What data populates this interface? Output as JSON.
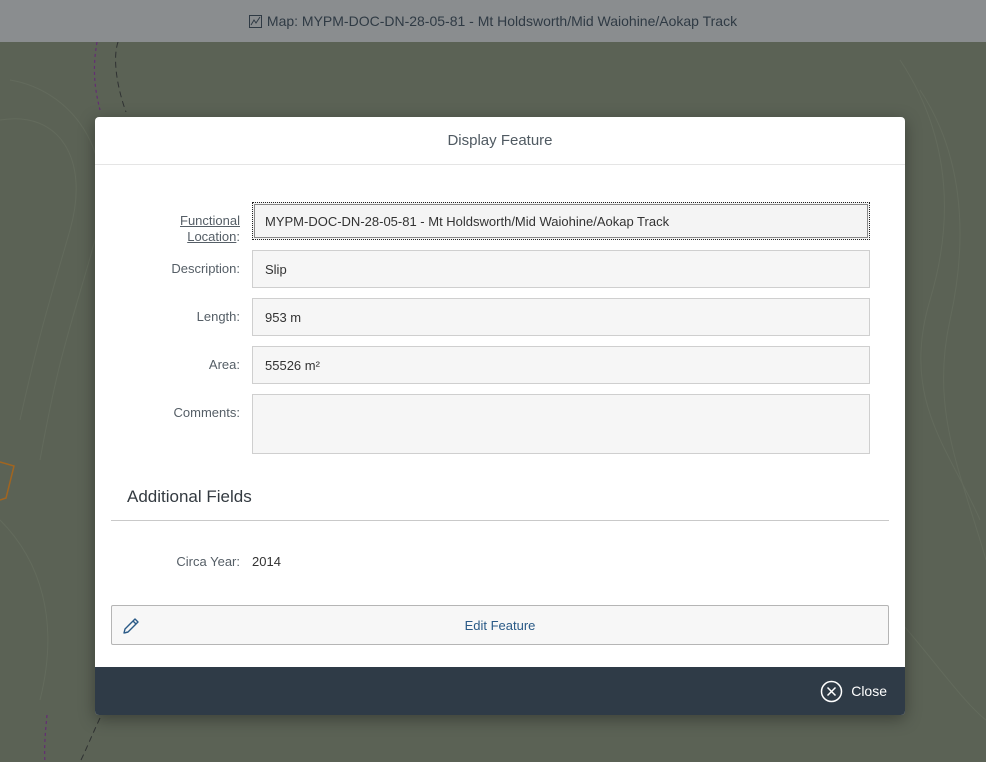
{
  "header": {
    "title": "Map: MYPM-DOC-DN-28-05-81 - Mt Holdsworth/Mid Waiohine/Aokap Track",
    "icon": "map-icon"
  },
  "dialog": {
    "title": "Display Feature",
    "fields": {
      "functional_location": {
        "label_line1": "Functional",
        "label_line2": "Location",
        "colon": ":",
        "value": "MYPM-DOC-DN-28-05-81 - Mt Holdsworth/Mid Waiohine/Aokap Track"
      },
      "description": {
        "label": "Description:",
        "value": "Slip"
      },
      "length": {
        "label": "Length:",
        "value": "953 m"
      },
      "area": {
        "label": "Area:",
        "value": "55526 m²"
      },
      "comments": {
        "label": "Comments:",
        "value": ""
      }
    },
    "additional": {
      "title": "Additional Fields",
      "circa_year_label": "Circa Year:",
      "circa_year_value": "2014"
    },
    "edit_button_label": "Edit Feature",
    "close_label": "Close"
  },
  "colors": {
    "footer": "#2f3b47",
    "link_blue": "#2a5a87",
    "map_bg": "#6f7763"
  }
}
